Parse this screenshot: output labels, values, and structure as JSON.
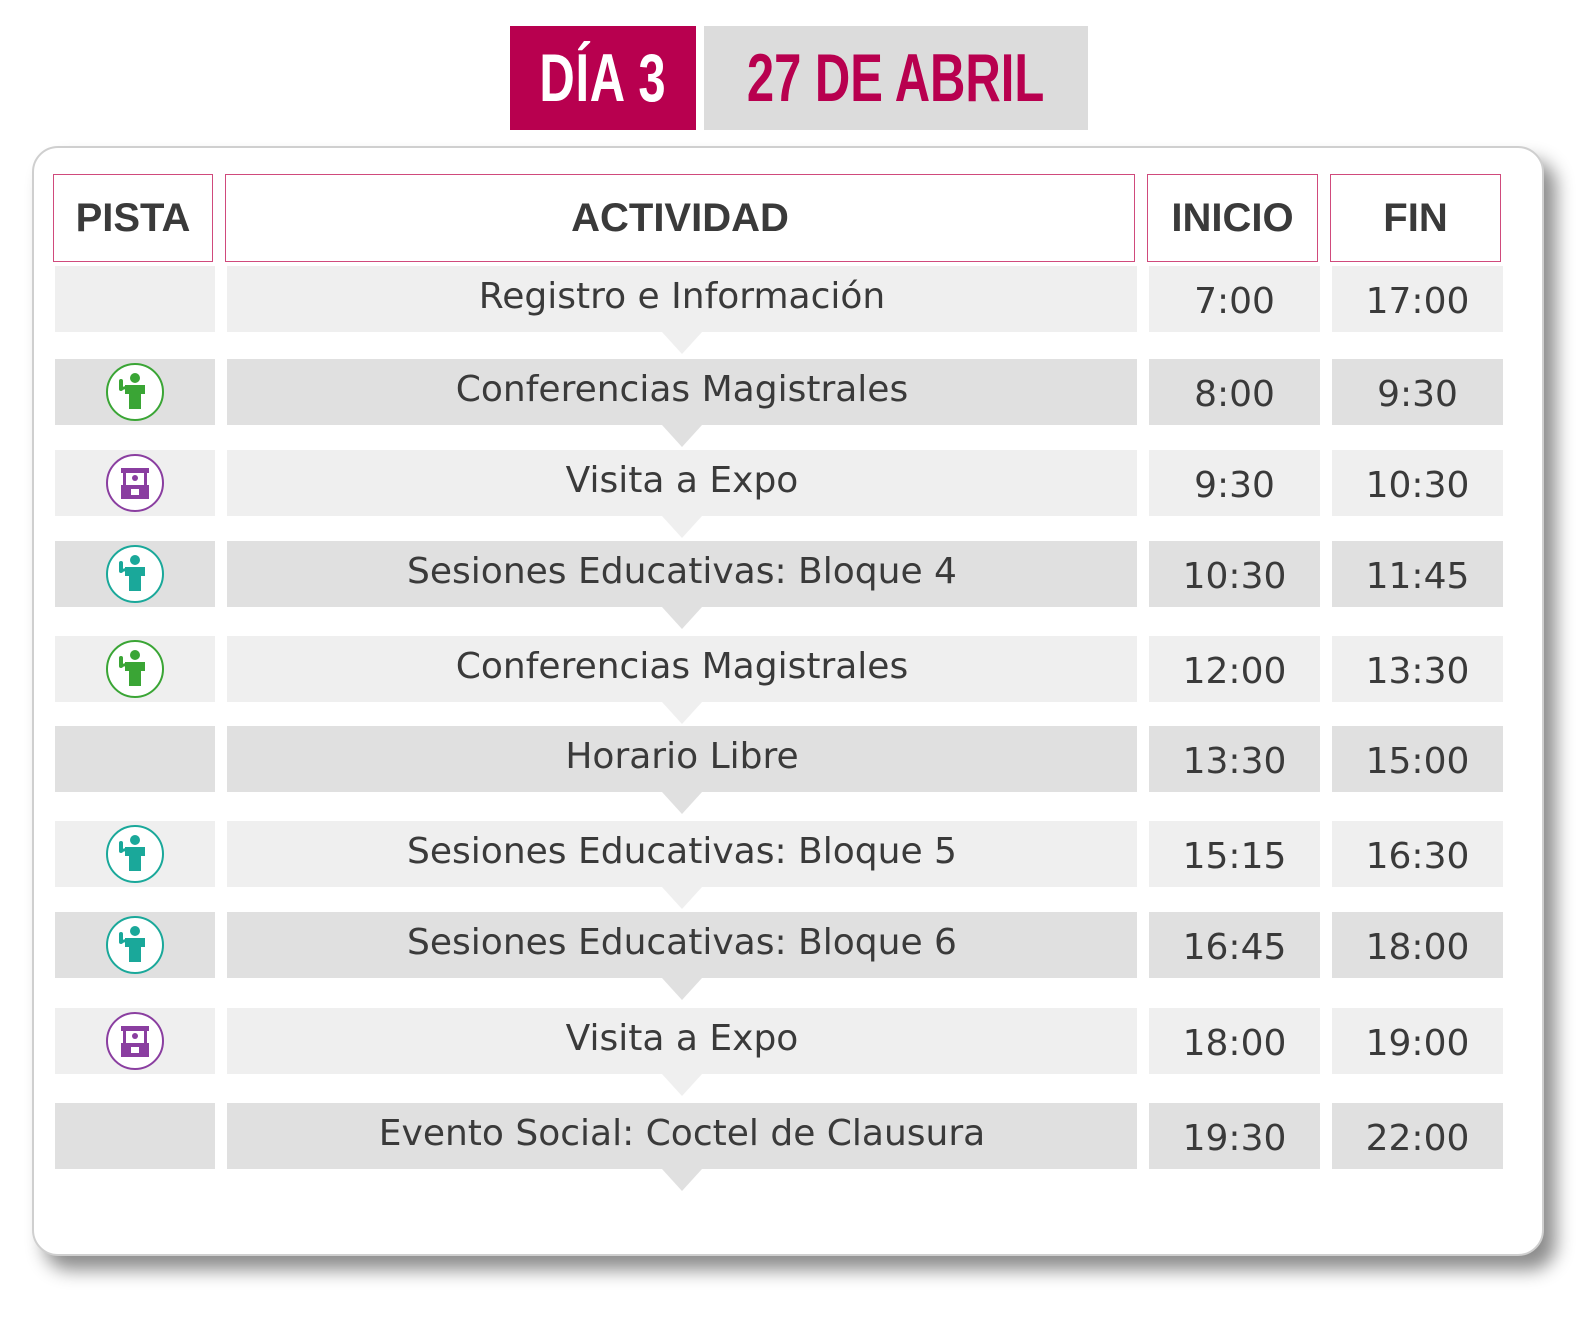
{
  "header": {
    "day": "DÍA 3",
    "date": "27 DE ABRIL"
  },
  "columns": {
    "pista": "PISTA",
    "actividad": "ACTIVIDAD",
    "inicio": "INICIO",
    "fin": "FIN"
  },
  "colors": {
    "accent": "#b8004f",
    "green_track": "#3aa535",
    "teal_track": "#1aa89a",
    "purple_track": "#8a3ea0"
  },
  "rows": [
    {
      "icon": "",
      "actividad": "Registro e Información",
      "inicio": "7:00",
      "fin": "17:00"
    },
    {
      "icon": "speaker-green-icon",
      "actividad": "Conferencias Magistrales",
      "inicio": "8:00",
      "fin": "9:30"
    },
    {
      "icon": "expo-booth-purple-icon",
      "actividad": "Visita a Expo",
      "inicio": "9:30",
      "fin": "10:30"
    },
    {
      "icon": "speaker-teal-icon",
      "actividad": "Sesiones Educativas: Bloque 4",
      "inicio": "10:30",
      "fin": "11:45"
    },
    {
      "icon": "speaker-green-icon",
      "actividad": "Conferencias Magistrales",
      "inicio": "12:00",
      "fin": "13:30"
    },
    {
      "icon": "",
      "actividad": "Horario Libre",
      "inicio": "13:30",
      "fin": "15:00"
    },
    {
      "icon": "speaker-teal-icon",
      "actividad": "Sesiones Educativas: Bloque 5",
      "inicio": "15:15",
      "fin": "16:30"
    },
    {
      "icon": "speaker-teal-icon",
      "actividad": "Sesiones Educativas: Bloque 6",
      "inicio": "16:45",
      "fin": "18:00"
    },
    {
      "icon": "expo-booth-purple-icon",
      "actividad": "Visita a Expo",
      "inicio": "18:00",
      "fin": "19:00"
    },
    {
      "icon": "",
      "actividad": "Evento Social: Coctel de Clausura",
      "inicio": "19:30",
      "fin": "22:00"
    }
  ]
}
